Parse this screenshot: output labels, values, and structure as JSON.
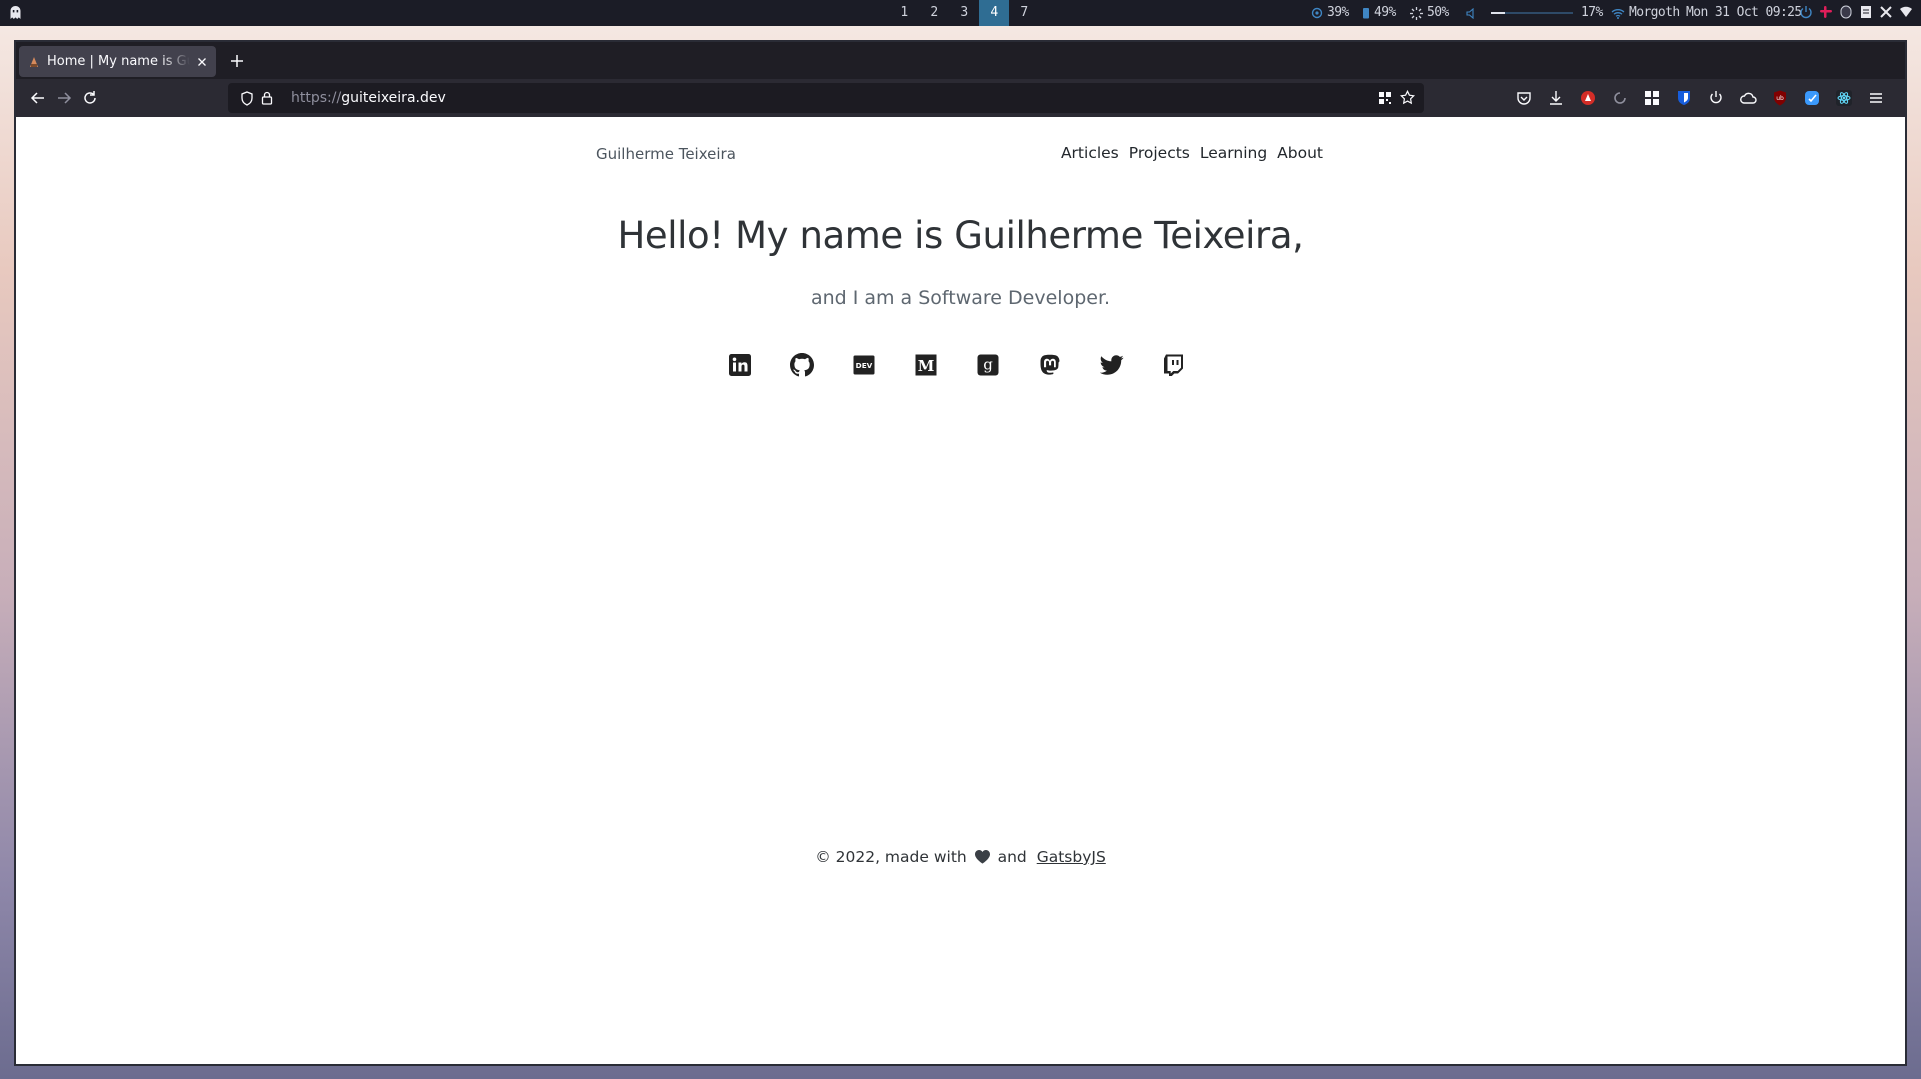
{
  "system_bar": {
    "workspaces": [
      "1",
      "2",
      "3",
      "4",
      "7"
    ],
    "active_workspace": "4",
    "cpu": "39%",
    "battery": "49%",
    "brightness": "50%",
    "volume_label": "17%",
    "volume_level": 0.17,
    "wifi_name": "Morgoth",
    "datetime": "Mon 31 Oct 09:25"
  },
  "browser": {
    "tab_title": "Home | My name is Guilherme Teixeira",
    "url_scheme": "https://",
    "url_host": "guiteixeira.dev",
    "icons": {
      "back": "back-arrow-icon",
      "forward": "forward-arrow-icon",
      "reload": "reload-icon",
      "tracking": "shield-icon",
      "lock": "lock-icon",
      "qr": "qr-code-icon",
      "bookmark": "star-icon",
      "menu": "hamburger-menu-icon"
    }
  },
  "site": {
    "name": "Guilherme Teixeira",
    "nav": [
      "Articles",
      "Projects",
      "Learning",
      "About"
    ],
    "hero_title": "Hello! My name is Guilherme Teixeira,",
    "hero_subtitle": "and I am a Software Developer.",
    "social": [
      "linkedin",
      "github",
      "dev.to",
      "medium",
      "goodreads",
      "mastodon",
      "twitter",
      "twitch"
    ],
    "footer_prefix": "© 2022, made with",
    "footer_and": "and",
    "footer_link": "GatsbyJS"
  },
  "colors": {
    "system_bar_bg": "#1b1c26",
    "active_workspace": "#2f6d93",
    "browser_chrome": "#2b2a33",
    "page_text": "#2f3337"
  }
}
